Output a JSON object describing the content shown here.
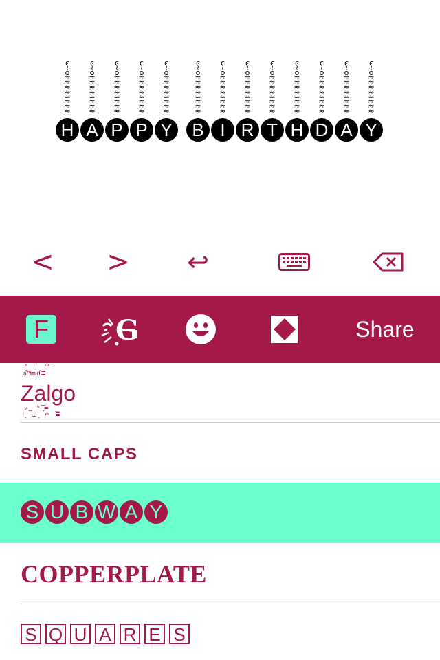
{
  "preview": {
    "words": [
      [
        "H",
        "A",
        "P",
        "P",
        "Y"
      ],
      [
        "B",
        "I",
        "R",
        "T",
        "H",
        "D",
        "A",
        "Y"
      ]
    ]
  },
  "edit_toolbar": {
    "back_glyph": "<",
    "forward_glyph": ">",
    "return_glyph": "↩",
    "keyboard_glyph": "⌨",
    "delete_glyph": "⌫"
  },
  "tab_bar": {
    "fonts_letter": "F",
    "share_label": "Share",
    "colors": {
      "bar": "#a5184a",
      "fonts_tile": "#6bf5cf",
      "text": "#ffffff"
    },
    "icons": [
      "fonts-icon",
      "graffiti-icon",
      "emoji-icon",
      "diamond-icon"
    ]
  },
  "styles": {
    "zalgo": "Zalgo",
    "small_caps": "SMALL CAPS",
    "subway": [
      "S",
      "U",
      "B",
      "W",
      "A",
      "Y"
    ],
    "copperplate": "COPPERPLATE",
    "squares": [
      "S",
      "Q",
      "U",
      "A",
      "R",
      "E",
      "S"
    ],
    "selected": "subway",
    "colors": {
      "accent": "#a5184a",
      "selected_bg": "#6bffd0"
    }
  }
}
